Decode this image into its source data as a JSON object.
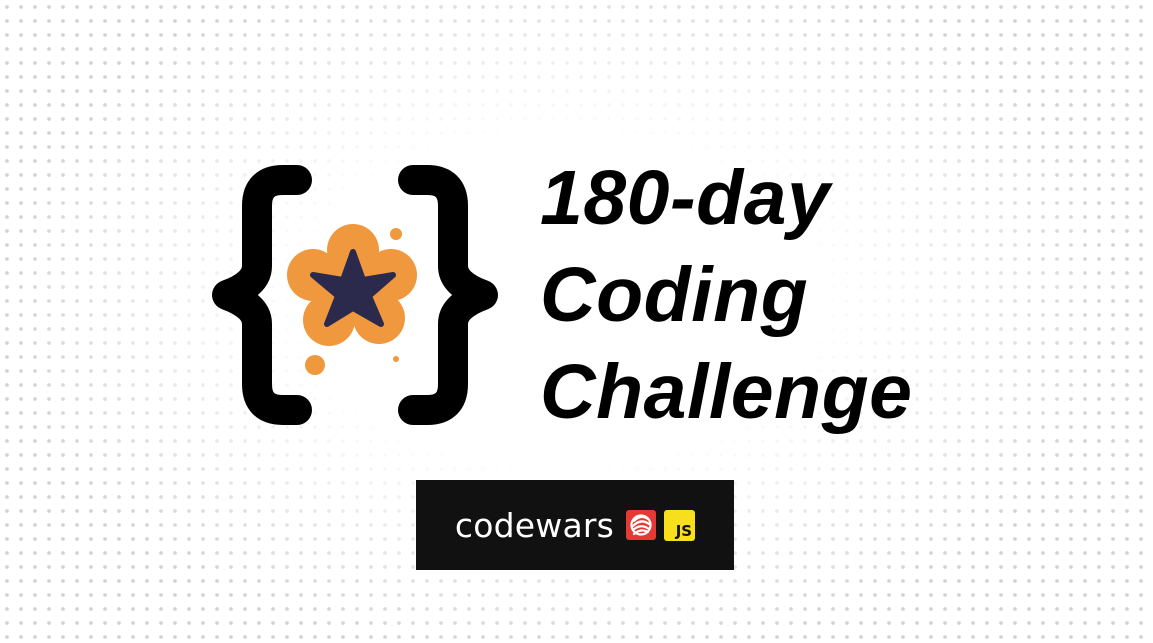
{
  "title": {
    "line1": "180-day",
    "line2": "Coding",
    "line3": "Challenge"
  },
  "badge": {
    "label": "codewars",
    "js_label": "JS"
  },
  "icons": {
    "logo": "curly-brace-flower-logo",
    "codewars": "codewars-logo-icon",
    "javascript": "javascript-icon"
  },
  "colors": {
    "flower_petals": "#F0983E",
    "flower_star": "#2B2A4C",
    "brace": "#000000",
    "badge_background": "#111111",
    "codewars_red": "#E53935",
    "js_yellow": "#F7DF1E"
  }
}
